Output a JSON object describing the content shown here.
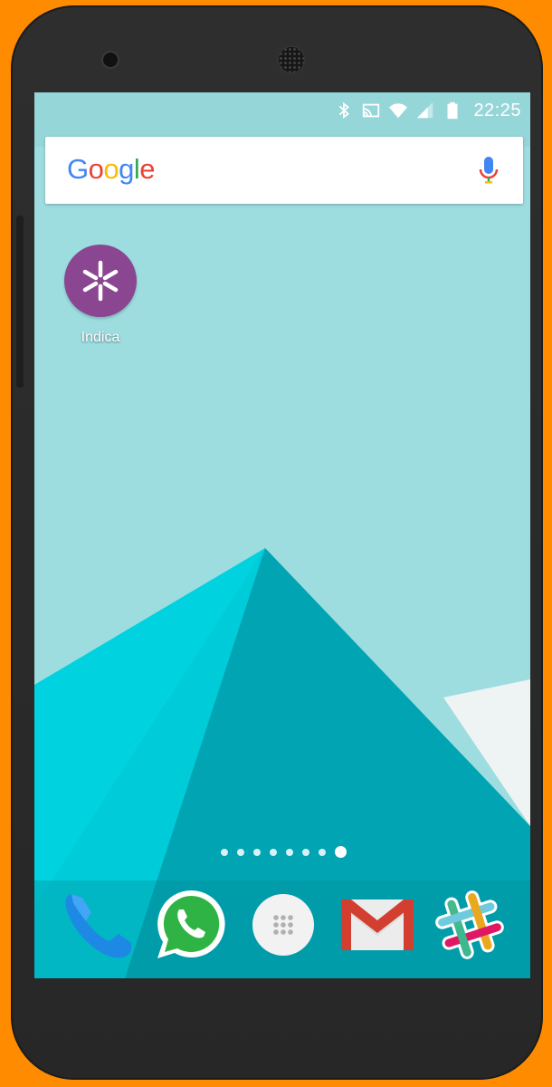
{
  "status_bar": {
    "time": "22:25",
    "icons": [
      "bluetooth-icon",
      "cast-icon",
      "wifi-icon",
      "signal-icon",
      "battery-icon"
    ]
  },
  "search": {
    "logo_letters": [
      {
        "char": "G",
        "color": "#4285F4"
      },
      {
        "char": "o",
        "color": "#EA4335"
      },
      {
        "char": "o",
        "color": "#FBBC05"
      },
      {
        "char": "g",
        "color": "#4285F4"
      },
      {
        "char": "l",
        "color": "#34A853"
      },
      {
        "char": "e",
        "color": "#EA4335"
      }
    ],
    "mic_icon": "mic-icon"
  },
  "home_apps": [
    {
      "label": "Indica",
      "icon": "indica-asterisk-icon",
      "color": "#8A4690"
    }
  ],
  "page_indicator": {
    "count": 8,
    "active": 8
  },
  "dock": [
    {
      "name": "phone",
      "icon": "phone-icon"
    },
    {
      "name": "whatsapp",
      "icon": "whatsapp-icon"
    },
    {
      "name": "app-drawer",
      "icon": "app-drawer-icon"
    },
    {
      "name": "gmail",
      "icon": "gmail-icon"
    },
    {
      "name": "slack",
      "icon": "slack-icon"
    }
  ],
  "colors": {
    "background": "#FF8C00",
    "wallpaper_sky": "#9DDDE0",
    "wallpaper_teal": "#00A7B5",
    "indica": "#8A4690"
  }
}
